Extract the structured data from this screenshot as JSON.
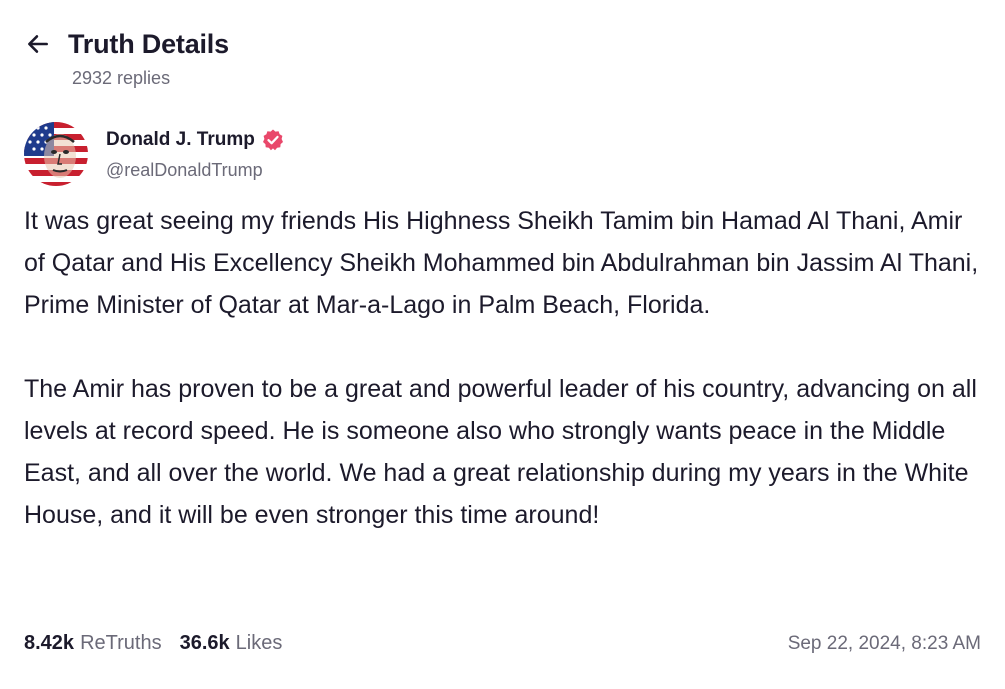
{
  "header": {
    "title": "Truth Details",
    "replies": "2932 replies",
    "back_icon": "arrow-left-icon"
  },
  "author": {
    "name": "Donald J. Trump",
    "handle": "@realDonaldTrump",
    "verified": true,
    "verified_color": "#e9486b"
  },
  "post": {
    "paragraphs": [
      "It was great seeing my friends His Highness Sheikh Tamim bin Hamad Al Thani, Amir of Qatar and His Excellency Sheikh Mohammed bin Abdulrahman bin Jassim Al Thani, Prime Minister of Qatar at Mar-a-Lago in Palm Beach, Florida.",
      "The Amir has proven to be a great and powerful leader of his country, advancing on all levels at record speed. He is someone also who strongly wants peace in the Middle East, and all over the world. We had a great relationship during my years in the White House, and it will be even stronger this time around!"
    ]
  },
  "stats": {
    "retruths_count": "8.42k",
    "retruths_label": "ReTruths",
    "likes_count": "36.6k",
    "likes_label": "Likes"
  },
  "timestamp": "Sep 22, 2024, 8:23 AM"
}
